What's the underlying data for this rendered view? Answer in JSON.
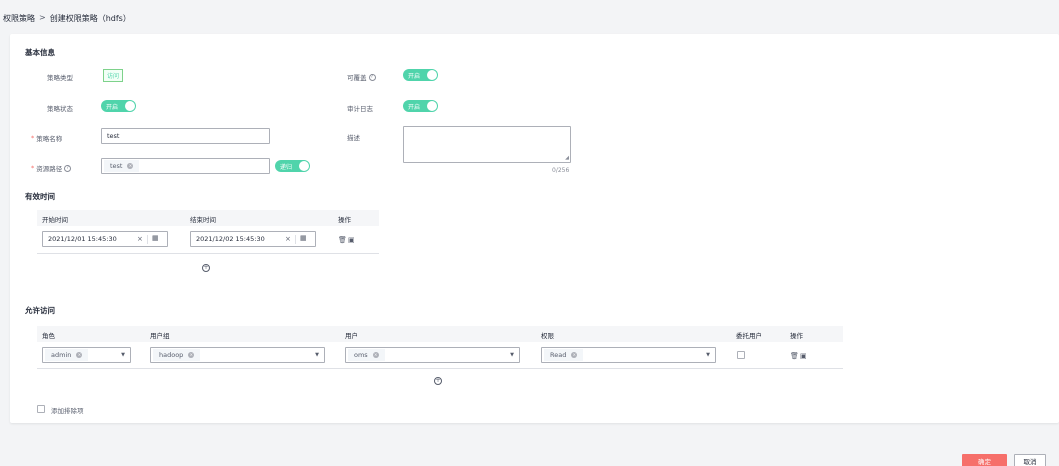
{
  "breadcrumb": {
    "parent": "权限策略",
    "separator": ">",
    "current": "创建权限策略（hdfs）"
  },
  "basic": {
    "title": "基本信息",
    "policy_type_label": "策略类型",
    "policy_type_value": "访问",
    "policy_status_label": "策略状态",
    "policy_status_value": "开启",
    "policy_name_label": "策略名称",
    "policy_name_value": "test",
    "resource_path_label": "资源路径",
    "resource_path_chip": "test",
    "recursive_label": "递归",
    "overridable_label": "可覆盖",
    "overridable_value": "开启",
    "audit_log_label": "审计日志",
    "audit_log_value": "开启",
    "description_label": "描述",
    "description_counter": "0/256"
  },
  "validity": {
    "title": "有效时间",
    "headers": {
      "start": "开始时间",
      "end": "结束时间",
      "ops": "操作"
    },
    "row": {
      "start": "2021/12/01 15:45:30",
      "end": "2021/12/02 15:45:30"
    }
  },
  "allow": {
    "title": "允许访问",
    "headers": {
      "role": "角色",
      "group": "用户组",
      "user": "用户",
      "permission": "权限",
      "delegate": "委托用户",
      "ops": "操作"
    },
    "row": {
      "role": "admin",
      "group": "hadoop",
      "user": "oms",
      "permission": "Read"
    }
  },
  "exclude_label": "添加排除项",
  "footer": {
    "confirm": "确定",
    "cancel": "取消"
  },
  "colors": {
    "accent_green": "#50d4ab",
    "primary_red": "#f66f6a"
  }
}
